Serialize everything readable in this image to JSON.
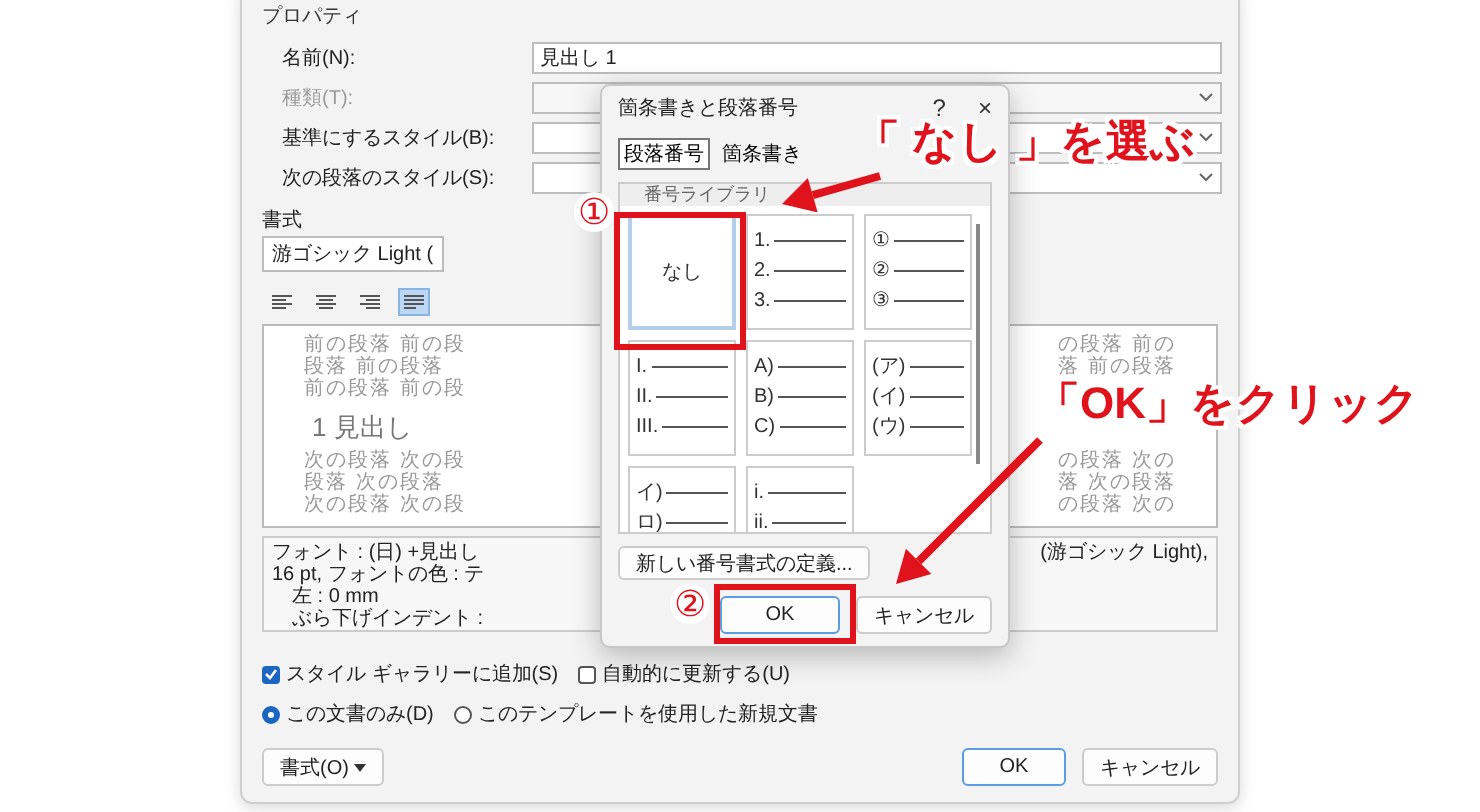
{
  "style_dialog": {
    "group_title": "プロパティ",
    "fields": [
      {
        "label": "名前(N):",
        "value": "見出し 1",
        "kind": "text",
        "disabled": false
      },
      {
        "label": "種類(T):",
        "kind": "select",
        "disabled": true
      },
      {
        "label": "基準にするスタイル(B):",
        "kind": "select",
        "disabled": false
      },
      {
        "label": "次の段落のスタイル(S):",
        "kind": "select",
        "disabled": false
      }
    ],
    "format_title": "書式",
    "font": "游ゴシック Light (",
    "alignment_buttons": [
      {
        "kind": "left",
        "selected": false
      },
      {
        "kind": "center",
        "selected": false
      },
      {
        "kind": "right",
        "selected": false
      },
      {
        "kind": "justify",
        "selected": true
      }
    ],
    "preview": {
      "before_left": [
        "前の段落 前の段",
        "段落 前の段落",
        "前の段落 前の段"
      ],
      "before_right": [
        "の段落 前の",
        "落 前の段落"
      ],
      "heading": "1 見出し",
      "after_left": [
        "次の段落 次の段",
        "段落 次の段落",
        "次の段落 次の段"
      ],
      "after_right": [
        "の段落 次の",
        "落 次の段落",
        "の段落 次の"
      ]
    },
    "description": {
      "lines_left": [
        "フォント : (日) +見出し",
        "16 pt, フォントの色 : テ",
        "左 :  0 mm",
        "ぶら下げインデント :"
      ],
      "line_right": "(游ゴシック Light),"
    },
    "checkboxes": [
      {
        "label": "スタイル ギャラリーに追加(S)",
        "checked": true
      },
      {
        "label": "自動的に更新する(U)",
        "checked": false
      }
    ],
    "radios": [
      {
        "label": "この文書のみ(D)",
        "selected": true
      },
      {
        "label": "このテンプレートを使用した新規文書",
        "selected": false
      }
    ],
    "format_button": "書式(O)",
    "buttons": [
      "OK",
      "キャンセル"
    ]
  },
  "numbering_dialog": {
    "title": "箇条書きと段落番号",
    "help": "?",
    "close": "×",
    "tabs": [
      {
        "label": "段落番号",
        "selected": true
      },
      {
        "label": "箇条書き",
        "selected": false
      }
    ],
    "gallery_title": "番号ライブラリ",
    "cells": [
      {
        "kind": "none",
        "label": "なし",
        "selected": true
      },
      {
        "kind": "list",
        "lines": [
          "1.",
          "2.",
          "3."
        ],
        "selected": false
      },
      {
        "kind": "list",
        "lines": [
          "①",
          "②",
          "③"
        ],
        "selected": false
      },
      {
        "kind": "list",
        "lines": [
          "I.",
          "II.",
          "III."
        ],
        "selected": false
      },
      {
        "kind": "list",
        "lines": [
          "A)",
          "B)",
          "C)"
        ],
        "selected": false
      },
      {
        "kind": "list",
        "lines": [
          "(ア)",
          "(イ)",
          "(ウ)"
        ],
        "selected": false
      },
      {
        "kind": "list",
        "lines": [
          "イ)",
          "ロ)"
        ],
        "selected": false
      },
      {
        "kind": "list",
        "lines": [
          "i.",
          "ii."
        ],
        "selected": false
      }
    ],
    "define_button": "新しい番号書式の定義...",
    "buttons": [
      "OK",
      "キャンセル"
    ]
  },
  "annotations": [
    {
      "marker": "①",
      "text": "「 なし 」を選ぶ"
    },
    {
      "marker": "②",
      "text": "「OK」をクリック"
    }
  ]
}
